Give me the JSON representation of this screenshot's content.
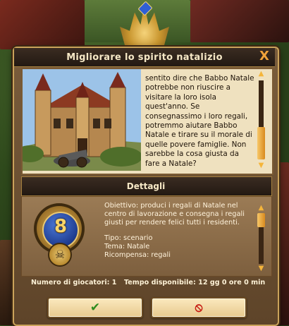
{
  "dialog": {
    "title": "Migliorare lo spirito natalizio",
    "close_label": "X"
  },
  "story": {
    "text": "sentito dire che Babbo Natale potrebbe non riuscire a visitare la loro isola quest'anno. Se consegnassimo i loro regali, potremmo aiutare Babbo Natale e tirare su il morale di quelle povere famiglie. Non sarebbe la cosa giusta da fare a Natale?"
  },
  "details": {
    "header": "Dettagli",
    "level_number": "8",
    "objective": "Obiettivo: produci i regali di Natale nel centro di lavorazione e consegna i regali giusti per rendere felici tutti i residenti.",
    "type_line": "Tipo: scenario",
    "theme_line": "Tema: Natale",
    "reward_line": "Ricompensa: regali"
  },
  "stats": {
    "players": "Numero di giocatori: 1",
    "time": "Tempo disponibile: 12 gg 0 ore 0 min"
  },
  "buttons": {
    "accept_icon": "✔",
    "decline_icon": "⦸"
  },
  "icons": {
    "close": "close-icon",
    "accept": "checkmark-icon",
    "decline": "forbidden-icon",
    "medal": "skull-medal-icon"
  },
  "colors": {
    "title_text": "#f6e8c6",
    "accent_orange": "#f0a33a",
    "accept_green": "#2d8c1f",
    "decline_red": "#c61b12",
    "medal_blue": "#1e3c8f",
    "medal_gold": "#f7d46a"
  }
}
